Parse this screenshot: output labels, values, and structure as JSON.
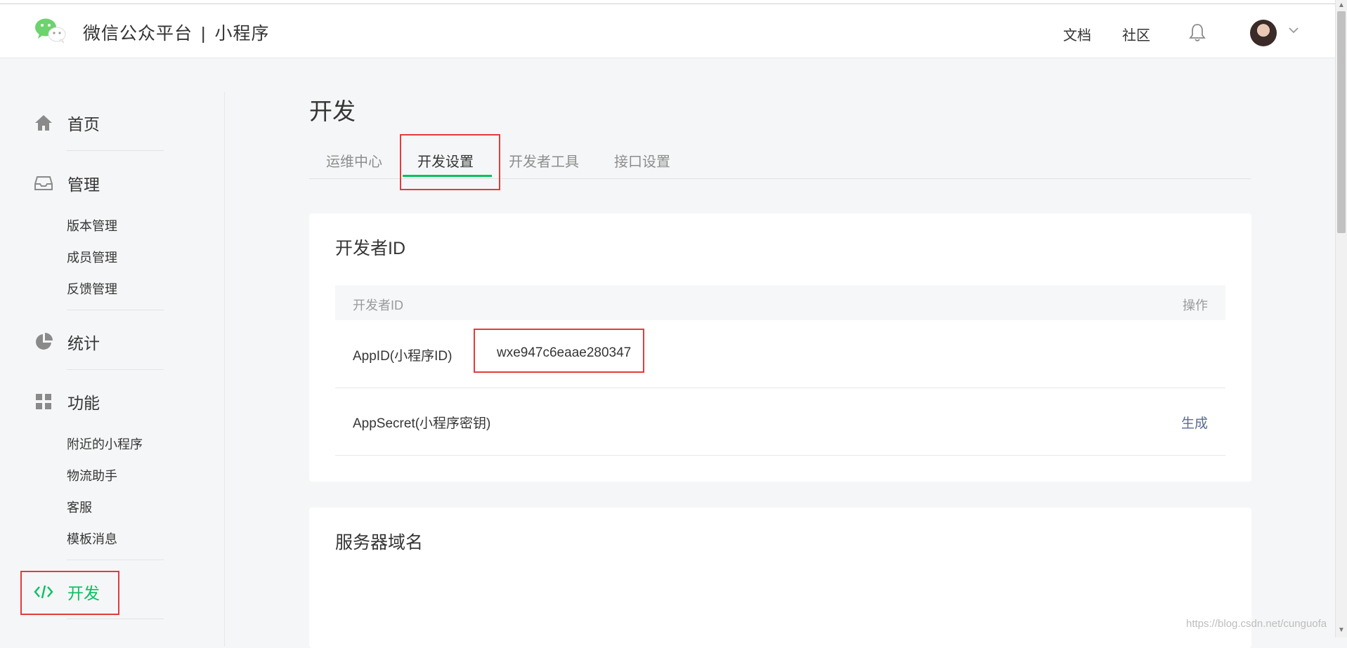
{
  "header": {
    "brand_name": "微信公众平台",
    "separator": "|",
    "product": "小程序",
    "docs_link": "文档",
    "community_link": "社区"
  },
  "sidebar": {
    "home": "首页",
    "manage": "管理",
    "manage_items": [
      "版本管理",
      "成员管理",
      "反馈管理"
    ],
    "stats": "统计",
    "features": "功能",
    "feature_items": [
      "附近的小程序",
      "物流助手",
      "客服",
      "模板消息"
    ],
    "develop": "开发"
  },
  "main": {
    "page_title": "开发",
    "tabs": [
      "运维中心",
      "开发设置",
      "开发者工具",
      "接口设置"
    ],
    "active_tab": "开发设置"
  },
  "developer_id_card": {
    "title": "开发者ID",
    "col_name": "开发者ID",
    "col_action": "操作",
    "rows": [
      {
        "key": "AppID(小程序ID)",
        "value": "wxe947c6eaae280347",
        "action": ""
      },
      {
        "key": "AppSecret(小程序密钥)",
        "value": "",
        "action": "生成"
      }
    ]
  },
  "server_domain_card": {
    "title": "服务器域名"
  },
  "watermark": "https://blog.csdn.net/cunguofa",
  "colors": {
    "accent_green": "#07c160",
    "highlight_red": "#e43b3b",
    "link_blue": "#576b95"
  },
  "icons": [
    "wechat-logo-icon",
    "bell-icon",
    "chevron-down-icon",
    "home-icon",
    "inbox-icon",
    "pie-chart-icon",
    "grid-icon",
    "code-icon"
  ]
}
